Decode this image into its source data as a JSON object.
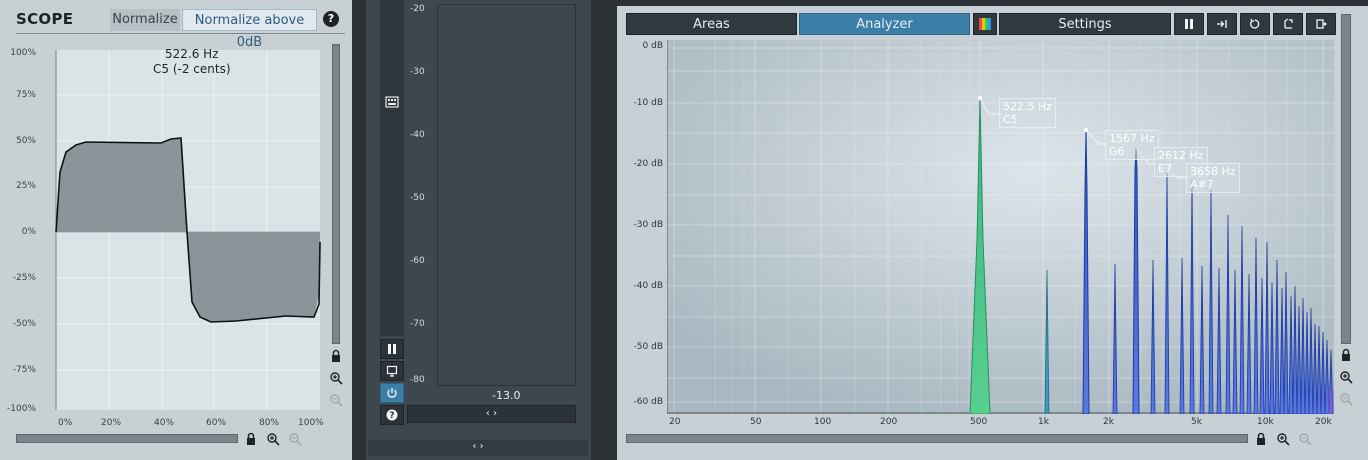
{
  "scope": {
    "title": "SCOPE",
    "normalize_label": "Normalize",
    "normalize_above_label": "Normalize above 0dB",
    "help_label": "?",
    "readout_freq": "522.6 Hz",
    "readout_note": "C5 (-2 cents)",
    "y_ticks": [
      "100%",
      "75%",
      "50%",
      "25%",
      "0%",
      "-25%",
      "-50%",
      "-75%",
      "-100%"
    ],
    "x_ticks": [
      "0%",
      "20%",
      "40%",
      "60%",
      "80%",
      "100%"
    ]
  },
  "meter": {
    "scale": [
      "-20",
      "-30",
      "-40",
      "-50",
      "-60",
      "-70",
      "-80"
    ],
    "value": "-13.0",
    "nav_label": "‹ ›",
    "bottom_nav_label": "‹ ›"
  },
  "analyzer": {
    "tabs": [
      "Areas",
      "Analyzer",
      "Settings"
    ],
    "db_ticks": [
      "0 dB",
      "-10 dB",
      "-20 dB",
      "-30 dB",
      "-40 dB",
      "-50 dB",
      "-60 dB"
    ],
    "freq_ticks": [
      "20",
      "50",
      "100",
      "200",
      "500",
      "1k",
      "2k",
      "5k",
      "10k",
      "20k"
    ],
    "peaks": [
      {
        "freq": "522.5 Hz",
        "note": "C5"
      },
      {
        "freq": "1567 Hz",
        "note": "G6"
      },
      {
        "freq": "2612 Hz",
        "note": "E7"
      },
      {
        "freq": "3658 Hz",
        "note": "A#7"
      }
    ]
  },
  "colors": {
    "accent": "#3b7fa8",
    "panel_light": "#c9d0d4",
    "panel_dark": "#3d474d",
    "peak_green": "#41c48a",
    "peak_blue": "#2d4fd0"
  }
}
